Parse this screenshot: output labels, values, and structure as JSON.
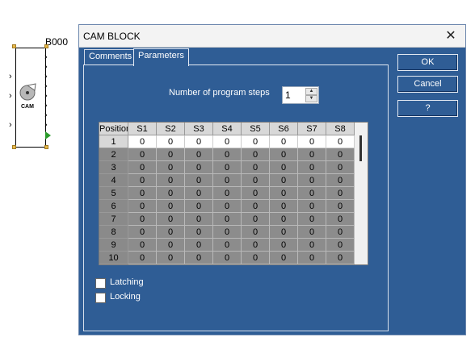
{
  "canvas": {
    "block_label": "B000",
    "block_text": "CAM"
  },
  "dialog": {
    "title": "CAM BLOCK",
    "tabs": [
      "Comments",
      "Parameters"
    ],
    "buttons": {
      "ok": "OK",
      "cancel": "Cancel",
      "help": "?"
    },
    "steps_label": "Number of program steps",
    "steps_value": "1",
    "grid": {
      "headers": [
        "Position",
        "S1",
        "S2",
        "S3",
        "S4",
        "S5",
        "S6",
        "S7",
        "S8"
      ],
      "rows": [
        [
          "1",
          "0",
          "0",
          "0",
          "0",
          "0",
          "0",
          "0",
          "0"
        ],
        [
          "2",
          "0",
          "0",
          "0",
          "0",
          "0",
          "0",
          "0",
          "0"
        ],
        [
          "3",
          "0",
          "0",
          "0",
          "0",
          "0",
          "0",
          "0",
          "0"
        ],
        [
          "4",
          "0",
          "0",
          "0",
          "0",
          "0",
          "0",
          "0",
          "0"
        ],
        [
          "5",
          "0",
          "0",
          "0",
          "0",
          "0",
          "0",
          "0",
          "0"
        ],
        [
          "6",
          "0",
          "0",
          "0",
          "0",
          "0",
          "0",
          "0",
          "0"
        ],
        [
          "7",
          "0",
          "0",
          "0",
          "0",
          "0",
          "0",
          "0",
          "0"
        ],
        [
          "8",
          "0",
          "0",
          "0",
          "0",
          "0",
          "0",
          "0",
          "0"
        ],
        [
          "9",
          "0",
          "0",
          "0",
          "0",
          "0",
          "0",
          "0",
          "0"
        ],
        [
          "10",
          "0",
          "0",
          "0",
          "0",
          "0",
          "0",
          "0",
          "0"
        ]
      ]
    },
    "checkboxes": [
      {
        "label": "Latching",
        "checked": false
      },
      {
        "label": "Locking",
        "checked": false
      }
    ]
  },
  "colors": {
    "dialog_bg": "#2f5d95",
    "grid_active_row": "#ffffff",
    "grid_inactive_row": "#8c8c8c",
    "handle": "#e8b84a",
    "output_arrow": "#2a9a2a"
  }
}
